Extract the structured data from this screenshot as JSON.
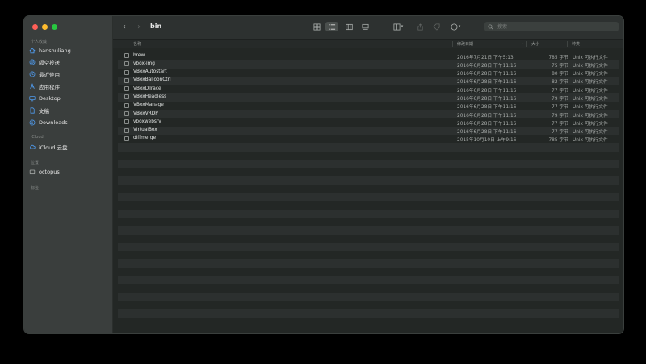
{
  "sidebar": {
    "sections": [
      {
        "title": "个人收藏",
        "items": [
          {
            "label": "hanshuliang",
            "icon": "home-icon"
          },
          {
            "label": "隔空投送",
            "icon": "airdrop-icon"
          },
          {
            "label": "最近使用",
            "icon": "clock-icon"
          },
          {
            "label": "应用程序",
            "icon": "apps-icon"
          },
          {
            "label": "Desktop",
            "icon": "desktop-icon"
          },
          {
            "label": "文稿",
            "icon": "document-icon"
          },
          {
            "label": "Downloads",
            "icon": "download-icon"
          }
        ]
      },
      {
        "title": "iCloud",
        "items": [
          {
            "label": "iCloud 云盘",
            "icon": "cloud-icon"
          }
        ]
      },
      {
        "title": "位置",
        "items": [
          {
            "label": "octopus",
            "icon": "computer-icon"
          }
        ]
      },
      {
        "title": "标签",
        "items": []
      }
    ]
  },
  "toolbar": {
    "title": "bin",
    "search_placeholder": "搜索"
  },
  "columns": {
    "name": "名称",
    "date": "修改日期",
    "size": "大小",
    "kind": "种类"
  },
  "files": [
    {
      "name": "brew",
      "date": "2016年7月21日 下午5:13",
      "size": "785 字节",
      "kind": "Unix 可执行文件"
    },
    {
      "name": "vbox-img",
      "date": "2016年6月28日 下午11:16",
      "size": "75 字节",
      "kind": "Unix 可执行文件"
    },
    {
      "name": "VBoxAutostart",
      "date": "2016年6月28日 下午11:16",
      "size": "80 字节",
      "kind": "Unix 可执行文件"
    },
    {
      "name": "VBoxBalloonCtrl",
      "date": "2016年6月28日 下午11:16",
      "size": "82 字节",
      "kind": "Unix 可执行文件"
    },
    {
      "name": "VBoxDTrace",
      "date": "2016年6月28日 下午11:16",
      "size": "77 字节",
      "kind": "Unix 可执行文件"
    },
    {
      "name": "VBoxHeadless",
      "date": "2016年6月28日 下午11:16",
      "size": "79 字节",
      "kind": "Unix 可执行文件"
    },
    {
      "name": "VBoxManage",
      "date": "2016年6月28日 下午11:16",
      "size": "77 字节",
      "kind": "Unix 可执行文件"
    },
    {
      "name": "VBoxVRDP",
      "date": "2016年6月28日 下午11:16",
      "size": "79 字节",
      "kind": "Unix 可执行文件"
    },
    {
      "name": "vboxwebsrv",
      "date": "2016年6月28日 下午11:16",
      "size": "77 字节",
      "kind": "Unix 可执行文件"
    },
    {
      "name": "VirtualBox",
      "date": "2016年6月28日 下午11:16",
      "size": "77 字节",
      "kind": "Unix 可执行文件"
    },
    {
      "name": "diffmerge",
      "date": "2015年10月10日 上午9:16",
      "size": "785 字节",
      "kind": "Unix 可执行文件"
    }
  ],
  "empty_rows": 22
}
